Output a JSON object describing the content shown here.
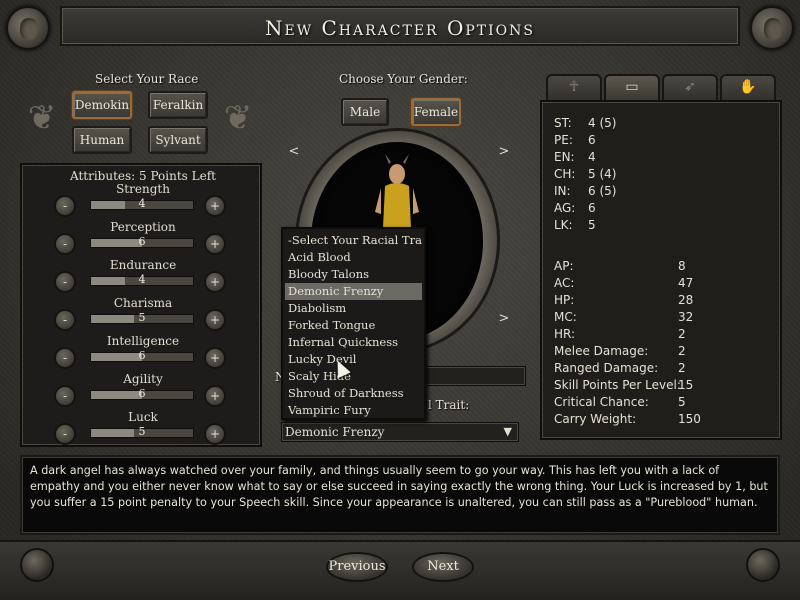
{
  "title": "New Character Options",
  "race": {
    "label": "Select Your Race",
    "options": [
      "Demokin",
      "Feralkin",
      "Human",
      "Sylvant"
    ],
    "selected": "Demokin"
  },
  "gender": {
    "label": "Choose Your Gender:",
    "options": [
      "Male",
      "Female"
    ],
    "selected": "Female",
    "prev_arrow": "<",
    "next_arrow": ">"
  },
  "attributes": {
    "header": "Attributes: 5 Points Left",
    "minus": "-",
    "plus": "+",
    "items": [
      {
        "name": "Strength",
        "value": "4"
      },
      {
        "name": "Perception",
        "value": "6"
      },
      {
        "name": "Endurance",
        "value": "4"
      },
      {
        "name": "Charisma",
        "value": "5"
      },
      {
        "name": "Intelligence",
        "value": "6"
      },
      {
        "name": "Agility",
        "value": "6"
      },
      {
        "name": "Luck",
        "value": "5"
      }
    ]
  },
  "tabs": [
    {
      "name": "body",
      "icon": "body-figure-icon"
    },
    {
      "name": "card",
      "icon": "id-card-icon"
    },
    {
      "name": "weapon",
      "icon": "bow-icon"
    },
    {
      "name": "hand",
      "icon": "hand-icon"
    }
  ],
  "stats_primary": [
    {
      "key": "ST:",
      "value": "4 (5)"
    },
    {
      "key": "PE:",
      "value": "6"
    },
    {
      "key": "EN:",
      "value": "4"
    },
    {
      "key": "CH:",
      "value": "5 (4)"
    },
    {
      "key": "IN:",
      "value": "6 (5)"
    },
    {
      "key": "AG:",
      "value": "6"
    },
    {
      "key": "LK:",
      "value": "5"
    }
  ],
  "stats_derived": [
    {
      "key": "AP:",
      "value": "8"
    },
    {
      "key": "AC:",
      "value": "47"
    },
    {
      "key": "HP:",
      "value": "28"
    },
    {
      "key": "MC:",
      "value": "32"
    },
    {
      "key": "HR:",
      "value": "2"
    },
    {
      "key": "Melee Damage:",
      "value": "2"
    },
    {
      "key": "Ranged Damage:",
      "value": "2"
    },
    {
      "key": "Skill Points Per Level:",
      "value": "15"
    },
    {
      "key": "Critical Chance:",
      "value": "5"
    },
    {
      "key": "Carry Weight:",
      "value": "150"
    }
  ],
  "racial_trait": {
    "label_partial": "l Trait:",
    "name_partial": "N",
    "selected": "Demonic Frenzy",
    "dropdown_arrow": "▼",
    "options": [
      "-Select Your Racial Trait-",
      "Acid Blood",
      "Bloody Talons",
      "Demonic Frenzy",
      "Diabolism",
      "Forked Tongue",
      "Infernal Quickness",
      "Lucky Devil",
      "Scaly Hide",
      "Shroud of Darkness",
      "Vampiric Fury"
    ],
    "highlighted": "Demonic Frenzy"
  },
  "description": "A dark angel has always watched over your family, and things usually seem to go your way. This has left you with a lack of empathy and you either never know what to say or else succeed in saying exactly the wrong thing. Your Luck is increased by 1, but you suffer a 15 point penalty to your Speech skill. Since your appearance is unaltered, you can still pass as a \"Pureblood\" human.",
  "nav": {
    "previous": "Previous",
    "next": "Next"
  },
  "colors": {
    "panel_bg": "#1d1c1a",
    "highlight": "#6c6a65",
    "active_border": "#9a6c3c"
  }
}
